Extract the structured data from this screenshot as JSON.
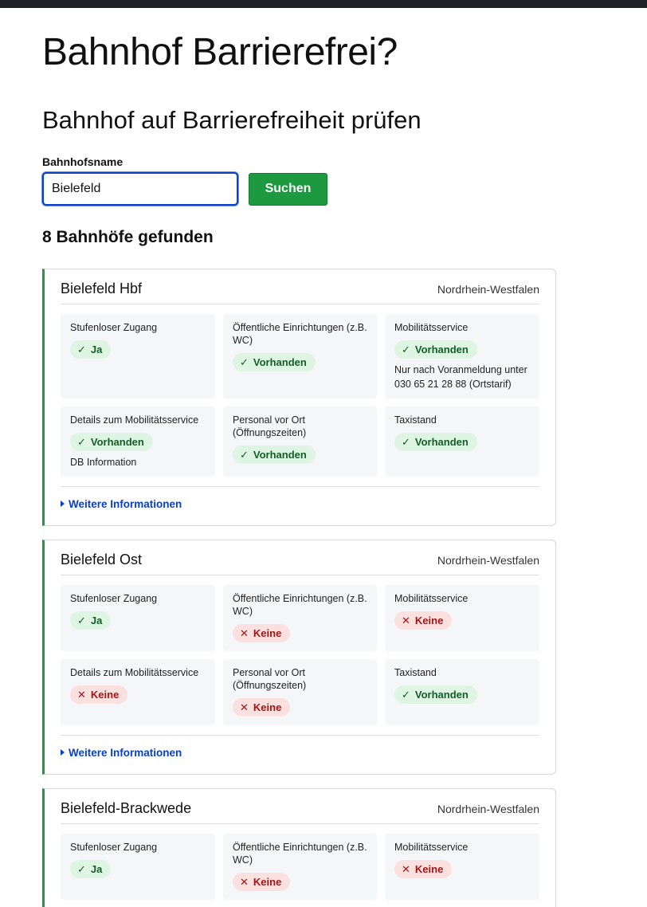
{
  "site_title": "Bahnhof Barrierefrei?",
  "page_heading": "Bahnhof auf Barrierefreiheit prüfen",
  "search": {
    "label": "Bahnhofsname",
    "value": "Bielefeld",
    "button_label": "Suchen"
  },
  "result_count": "8 Bahnhöfe gefunden",
  "more_info_label": "Weitere Informationen",
  "colors": {
    "accent_green": "#1d9a3f",
    "focus_blue": "#0a41c8",
    "ok_bg": "#dff5e4",
    "no_bg": "#fbe0e0"
  },
  "stations": [
    {
      "name": "Bielefeld Hbf",
      "state": "Nordrhein-Westfalen",
      "features": [
        {
          "label": "Stufenloser Zugang",
          "status": "Ja",
          "ok": true
        },
        {
          "label": "Öffentliche Einrichtungen (z.B. WC)",
          "status": "Vorhanden",
          "ok": true
        },
        {
          "label": "Mobilitätsservice",
          "status": "Vorhanden",
          "ok": true,
          "note": "Nur nach Voranmeldung unter 030 65 21 28 88 (Ortstarif)"
        },
        {
          "label": "Details zum Mobilitätsservice",
          "status": "Vorhanden",
          "ok": true,
          "note": "DB Information"
        },
        {
          "label": "Personal vor Ort (Öffnungszeiten)",
          "status": "Vorhanden",
          "ok": true
        },
        {
          "label": "Taxistand",
          "status": "Vorhanden",
          "ok": true
        }
      ]
    },
    {
      "name": "Bielefeld Ost",
      "state": "Nordrhein-Westfalen",
      "features": [
        {
          "label": "Stufenloser Zugang",
          "status": "Ja",
          "ok": true
        },
        {
          "label": "Öffentliche Einrichtungen (z.B. WC)",
          "status": "Keine",
          "ok": false
        },
        {
          "label": "Mobilitätsservice",
          "status": "Keine",
          "ok": false
        },
        {
          "label": "Details zum Mobilitätsservice",
          "status": "Keine",
          "ok": false
        },
        {
          "label": "Personal vor Ort (Öffnungszeiten)",
          "status": "Keine",
          "ok": false
        },
        {
          "label": "Taxistand",
          "status": "Vorhanden",
          "ok": true
        }
      ]
    },
    {
      "name": "Bielefeld-Brackwede",
      "state": "Nordrhein-Westfalen",
      "features": [
        {
          "label": "Stufenloser Zugang",
          "status": "Ja",
          "ok": true
        },
        {
          "label": "Öffentliche Einrichtungen (z.B. WC)",
          "status": "Keine",
          "ok": false
        },
        {
          "label": "Mobilitätsservice",
          "status": "Keine",
          "ok": false
        }
      ]
    }
  ]
}
